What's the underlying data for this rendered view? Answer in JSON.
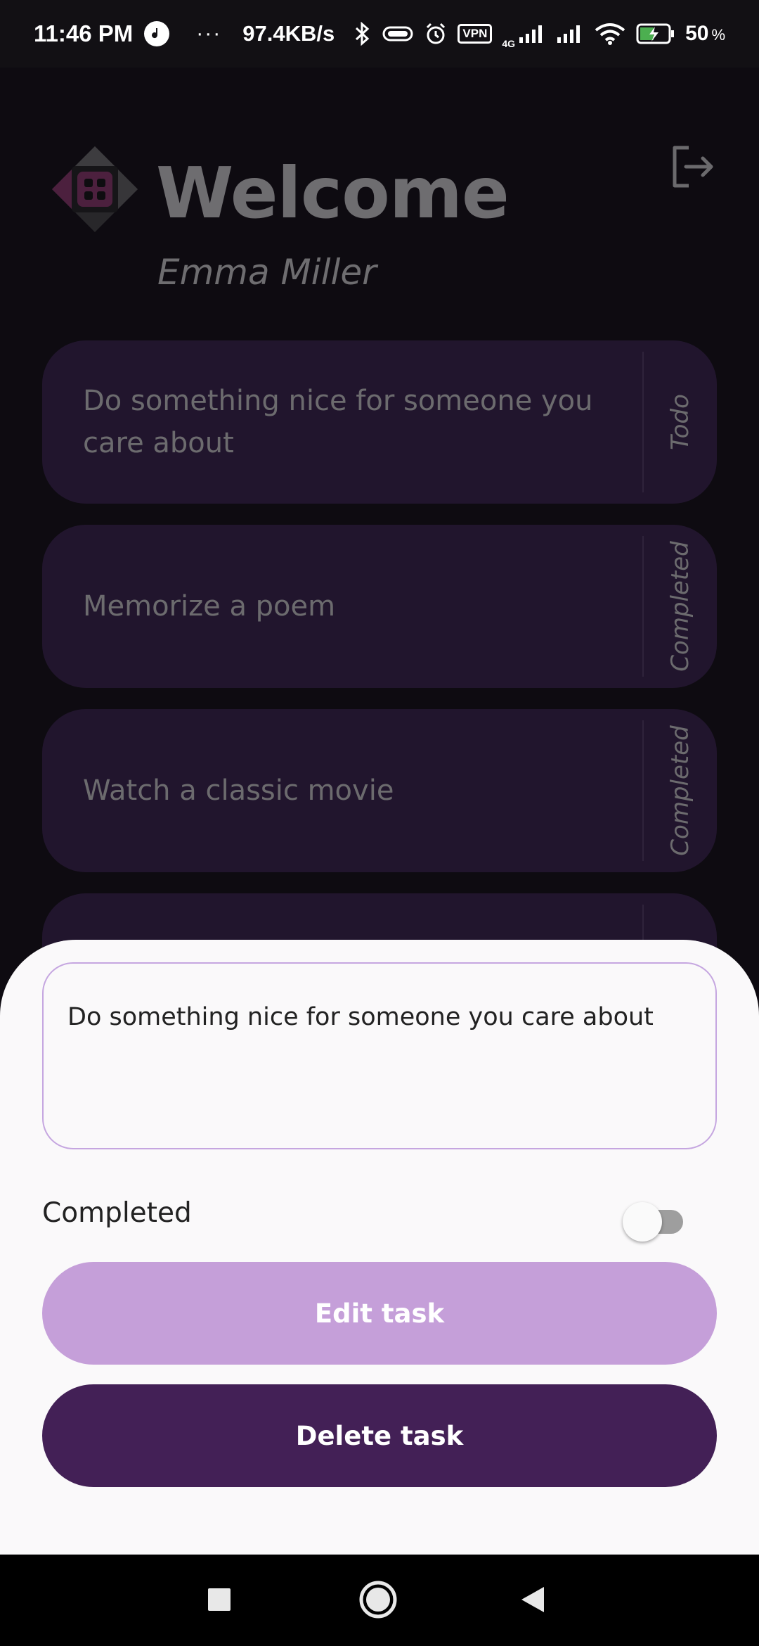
{
  "status_bar": {
    "time": "11:46 PM",
    "more": "···",
    "network_speed": "97.4KB/s",
    "vpn": "VPN",
    "network_type": "4G",
    "battery_level": "50",
    "battery_unit": "%"
  },
  "header": {
    "welcome": "Welcome",
    "user_name": "Emma Miller"
  },
  "tasks": [
    {
      "text": "Do something nice for someone you care about",
      "status": "Todo"
    },
    {
      "text": "Memorize a poem",
      "status": "Completed"
    },
    {
      "text": "Watch a classic movie",
      "status": "Completed"
    },
    {
      "text": "",
      "status": ""
    }
  ],
  "sheet": {
    "task_value": "Do something nice for someone you care about",
    "completed_label": "Completed",
    "completed_on": false,
    "edit_label": "Edit task",
    "delete_label": "Delete task"
  },
  "colors": {
    "card": "#3a2352",
    "edit_button": "#c59fd9",
    "delete_button": "#432056",
    "input_border": "#c5a6e0"
  }
}
